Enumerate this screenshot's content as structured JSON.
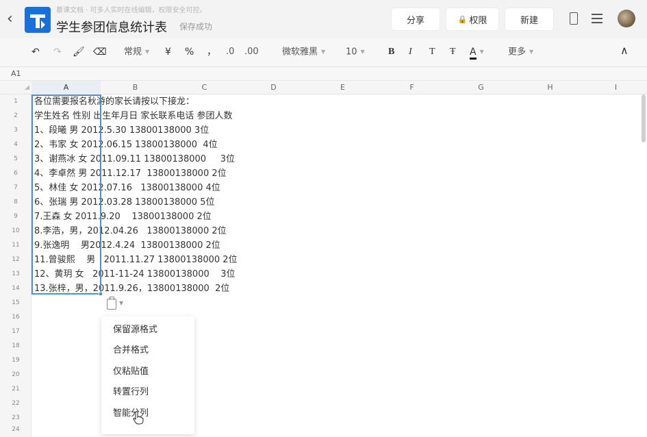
{
  "header": {
    "promo": "慕课文档 · 可多人实时在线编辑，权限安全可控。",
    "title": "学生参团信息统计表",
    "save_status": "保存成功",
    "share": "分享",
    "permission": "权限",
    "new": "新建",
    "brand_color": "#1a6fd8"
  },
  "toolbar": {
    "format": "常规",
    "currency": "¥",
    "percent": "%",
    "comma": "，",
    "dec_down": ".0",
    "dec_up": ".00",
    "font": "微软雅黑",
    "size": "10",
    "bold": "B",
    "italic": "I",
    "strike_t": "T",
    "strike": "Ŧ",
    "font_color": "A",
    "more": "更多"
  },
  "namebox": {
    "ref": "A1"
  },
  "columns": [
    "A",
    "B",
    "C",
    "D",
    "E",
    "F",
    "G",
    "H",
    "I"
  ],
  "rows": [
    "1",
    "2",
    "3",
    "4",
    "5",
    "6",
    "7",
    "8",
    "9",
    "10",
    "11",
    "12",
    "13",
    "14",
    "15",
    "16",
    "17",
    "18",
    "19",
    "20",
    "21",
    "22",
    "23",
    "24"
  ],
  "cells": [
    "各位需要报名秋游的家长请按以下接龙：",
    "学生姓名 性别 出生年月日 家长联系电话 参团人数",
    "1、段曦 男 2012.5.30 13800138000 3位",
    "2、韦家 女 2012.06.15 13800138000  4位",
    "3、谢燕冰 女 2011.09.11 13800138000     3位",
    "4、李卓然 男 2011.12.17  13800138000 2位",
    "5、林佳 女 2012.07.16   13800138000 4位",
    "6、张瑞 男 2012.03.28 13800138000 5位",
    "7.王森 女 2011.9.20    13800138000 2位",
    "8.李浩，男，2012.04.26   13800138000 2位",
    "9.张逸明    男2012.4.24  13800138000 2位",
    "11.曾骏熙    男   2011.11.27 13800138000 2位",
    "12、黄玥 女   2011-11-24 13800138000    3位",
    "13.张梓，男，2011.9.26，13800138000  2位"
  ],
  "paste_menu": [
    "保留源格式",
    "合并格式",
    "仅粘贴值",
    "转置行列",
    "智能分列"
  ]
}
